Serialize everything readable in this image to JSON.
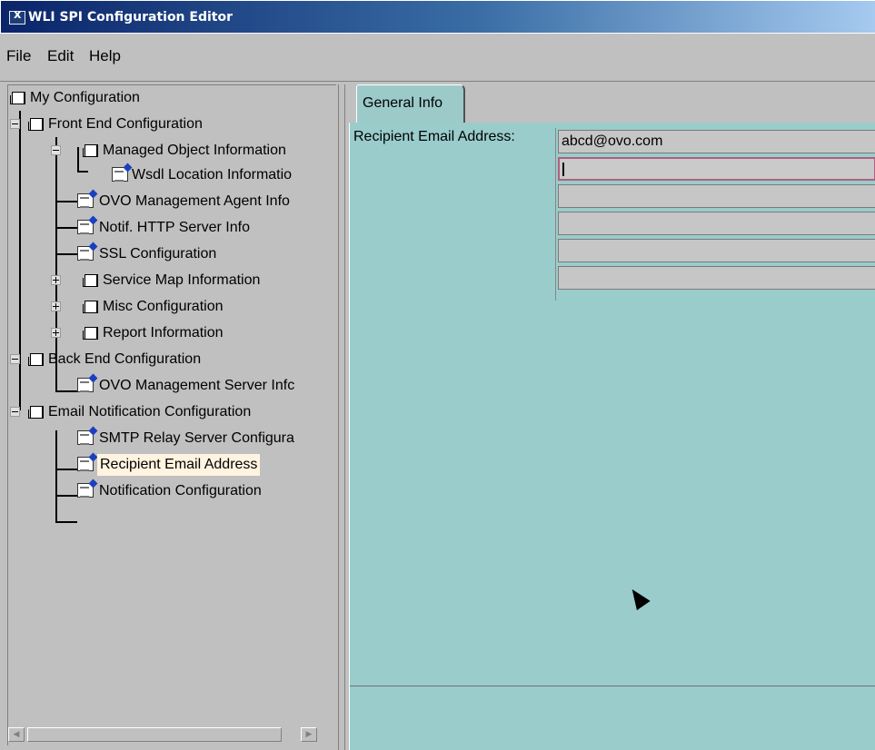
{
  "window": {
    "title": "WLI SPI Configuration Editor",
    "app_icon": "java-app-icon"
  },
  "menu": {
    "items": [
      "File",
      "Edit",
      "Help"
    ]
  },
  "tree": {
    "root": "My Configuration",
    "nodes": [
      {
        "label": "Front End Configuration"
      },
      {
        "label": "Managed Object Information"
      },
      {
        "label": "Wsdl Location Informatio"
      },
      {
        "label": "OVO Management Agent Info"
      },
      {
        "label": "Notif. HTTP Server Info"
      },
      {
        "label": "SSL Configuration"
      },
      {
        "label": "Service Map Information"
      },
      {
        "label": "Misc Configuration"
      },
      {
        "label": "Report Information"
      },
      {
        "label": "Back End Configuration"
      },
      {
        "label": "OVO Management Server Infc"
      },
      {
        "label": "Email Notification Configuration"
      },
      {
        "label": "SMTP Relay Server Configura"
      },
      {
        "label": "Recipient Email Address"
      },
      {
        "label": "Notification Configuration"
      }
    ],
    "selected": "Recipient Email Address"
  },
  "tabs": [
    {
      "label": "General Info"
    }
  ],
  "form": {
    "label": "Recipient Email Address:",
    "values": [
      "abcd@ovo.com",
      "",
      "",
      "",
      "",
      ""
    ]
  },
  "colors": {
    "panel": "#99cccb",
    "titlebar": "#0a246a",
    "selection": "#fff4e0"
  }
}
